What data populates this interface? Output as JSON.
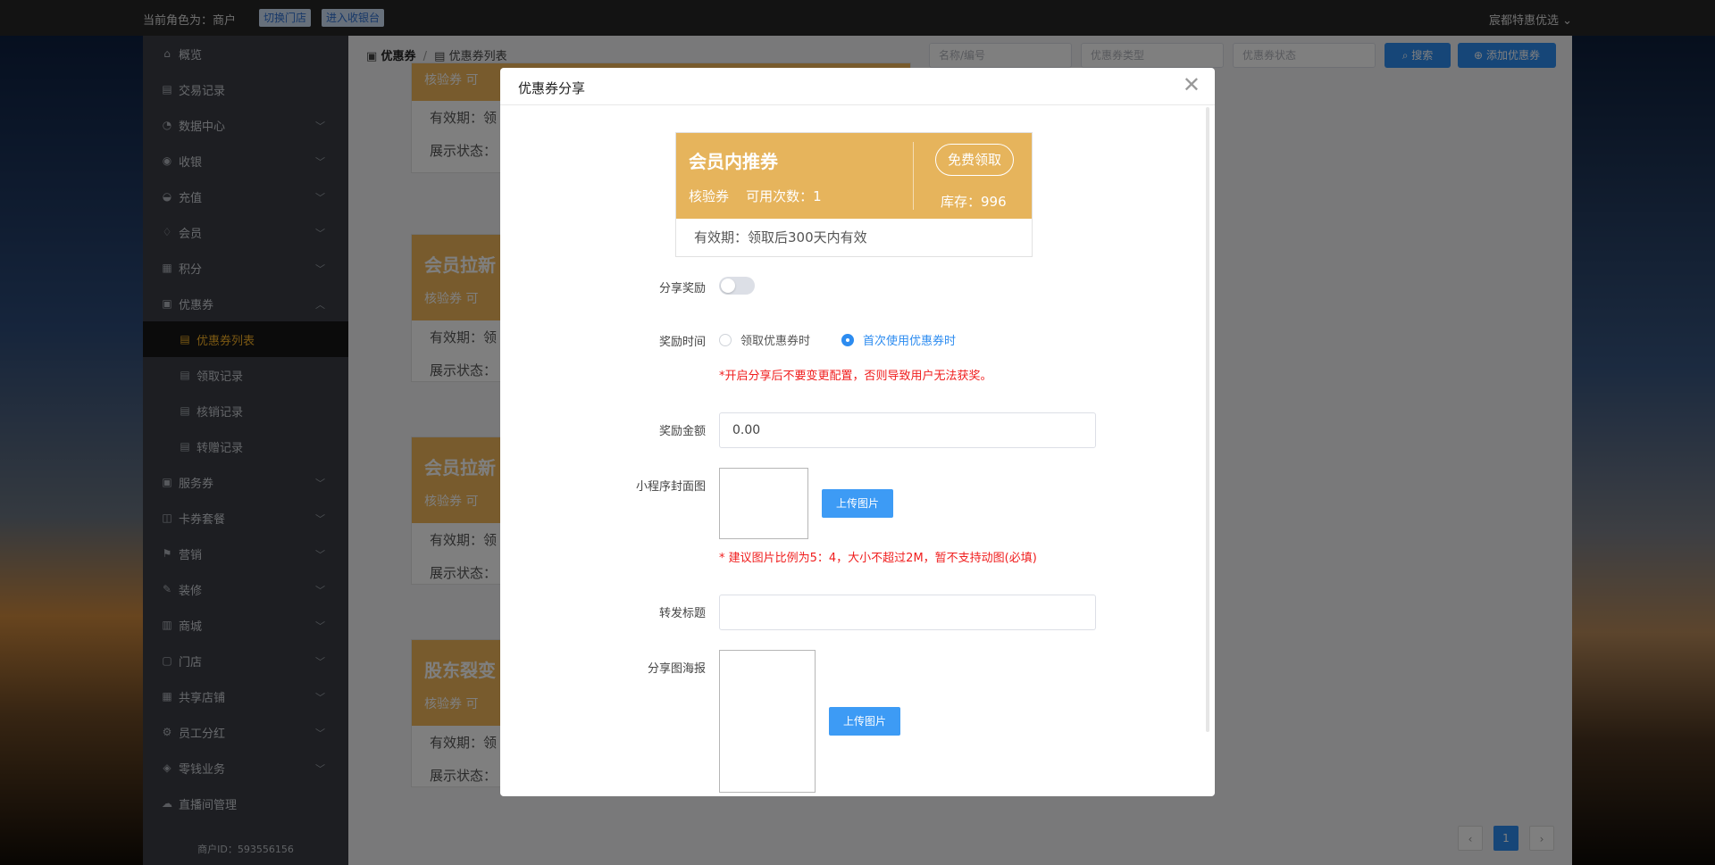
{
  "topbar": {
    "role_text": "当前角色为：商户",
    "switch_store": "切换门店",
    "enter_cashier": "进入收银台",
    "store_name": "宸都特惠优选"
  },
  "sidebar": {
    "items": [
      {
        "label": "概览",
        "icon": "home-icon",
        "expandable": false
      },
      {
        "label": "交易记录",
        "icon": "document-icon",
        "expandable": false
      },
      {
        "label": "数据中心",
        "icon": "chart-icon",
        "expandable": true
      },
      {
        "label": "收银",
        "icon": "cashier-icon",
        "expandable": true
      },
      {
        "label": "充值",
        "icon": "recharge-icon",
        "expandable": true
      },
      {
        "label": "会员",
        "icon": "member-icon",
        "expandable": true
      },
      {
        "label": "积分",
        "icon": "points-icon",
        "expandable": true
      },
      {
        "label": "优惠券",
        "icon": "coupon-icon",
        "expandable": true,
        "expanded": true
      }
    ],
    "coupon_sub": [
      {
        "label": "优惠券列表",
        "active": true
      },
      {
        "label": "领取记录",
        "active": false
      },
      {
        "label": "核销记录",
        "active": false
      },
      {
        "label": "转赠记录",
        "active": false
      }
    ],
    "items_after": [
      {
        "label": "服务券",
        "icon": "ticket-icon"
      },
      {
        "label": "卡券套餐",
        "icon": "bag-icon"
      },
      {
        "label": "营销",
        "icon": "marketing-icon"
      },
      {
        "label": "装修",
        "icon": "edit-icon"
      },
      {
        "label": "商城",
        "icon": "shop-icon"
      },
      {
        "label": "门店",
        "icon": "store-icon"
      },
      {
        "label": "共享店铺",
        "icon": "share-store-icon"
      },
      {
        "label": "员工分红",
        "icon": "dividend-icon"
      },
      {
        "label": "零钱业务",
        "icon": "wallet-icon"
      },
      {
        "label": "直播间管理",
        "icon": "live-icon"
      }
    ],
    "merchant_id": "商户ID：593556156"
  },
  "content": {
    "breadcrumb_root": "优惠券",
    "breadcrumb_sep": "/",
    "breadcrumb_current": "优惠券列表",
    "search_placeholder": "名称/编号",
    "type_placeholder": "优惠券类型",
    "status_placeholder": "优惠券状态",
    "search_btn": "搜索",
    "add_btn": "添加优惠券",
    "bg_cards": [
      {
        "title": "",
        "sub": "核验券  可",
        "valid": "有效期：领",
        "show": "展示状态："
      },
      {
        "title": "会员拉新",
        "sub": "核验券  可",
        "valid": "有效期：领",
        "show": "展示状态："
      },
      {
        "title": "会员拉新",
        "sub": "核验券  可",
        "valid": "有效期：领",
        "show": "展示状态："
      },
      {
        "title": "股东裂变",
        "sub": "核验券  可",
        "valid": "有效期：领",
        "show": "展示状态："
      }
    ],
    "pager_current": "1"
  },
  "modal": {
    "title": "优惠券分享",
    "coupon": {
      "name": "会员内推券",
      "meta": "核验券    可用次数：1",
      "get_label": "免费领取",
      "stock": "库存：996",
      "valid": "有效期：领取后300天内有效"
    },
    "share_reward_label": "分享奖励",
    "share_reward_on": false,
    "reward_time_label": "奖励时间",
    "reward_time_options": [
      "领取优惠券时",
      "首次使用优惠券时"
    ],
    "reward_time_selected": 1,
    "reward_warning": "*开启分享后不要变更配置，否则导致用户无法获奖。",
    "reward_amount_label": "奖励金额",
    "reward_amount_value": "0.00",
    "cover_label": "小程序封面图",
    "upload_label": "上传图片",
    "cover_hint": "* 建议图片比例为5：4，大小不超过2M，暂不支持动图(必填)",
    "forward_title_label": "转发标题",
    "forward_title_value": "",
    "poster_label": "分享图海报",
    "poster_upload_label": "上传图片"
  }
}
